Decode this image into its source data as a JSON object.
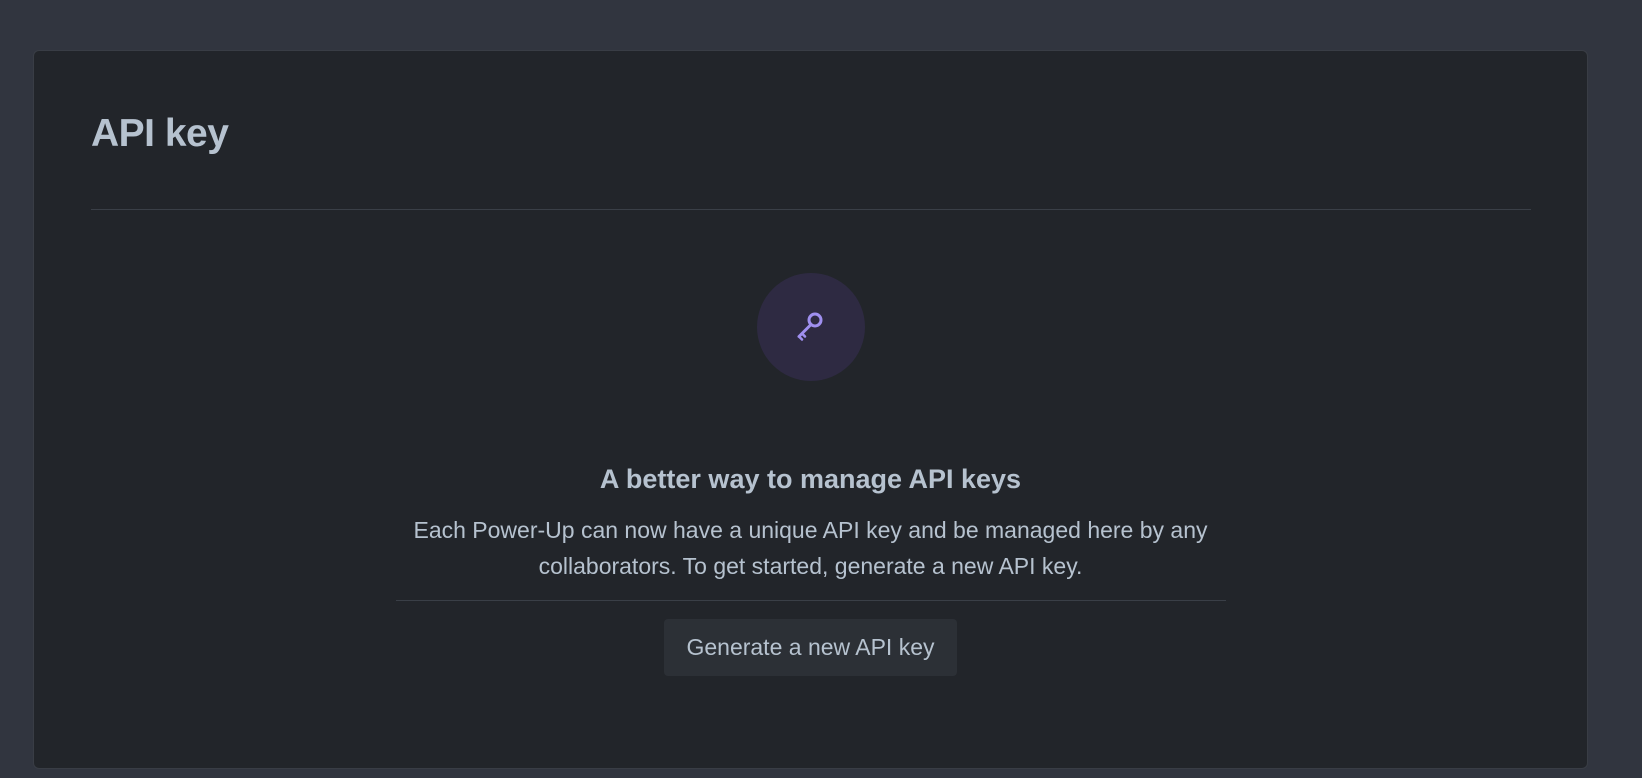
{
  "panel": {
    "title": "API key"
  },
  "empty_state": {
    "icon": "key-icon",
    "heading": "A better way to manage API keys",
    "description": "Each Power-Up can now have a unique API key and be managed here by any collaborators. To get started, generate a new API key.",
    "button_label": "Generate a new API key"
  },
  "colors": {
    "page_background": "#31353f",
    "panel_background": "#22252a",
    "text": "#b6c2cf",
    "icon_circle": "#2e2a42",
    "icon_accent": "#9f8fef",
    "button_background": "#2c3036"
  }
}
